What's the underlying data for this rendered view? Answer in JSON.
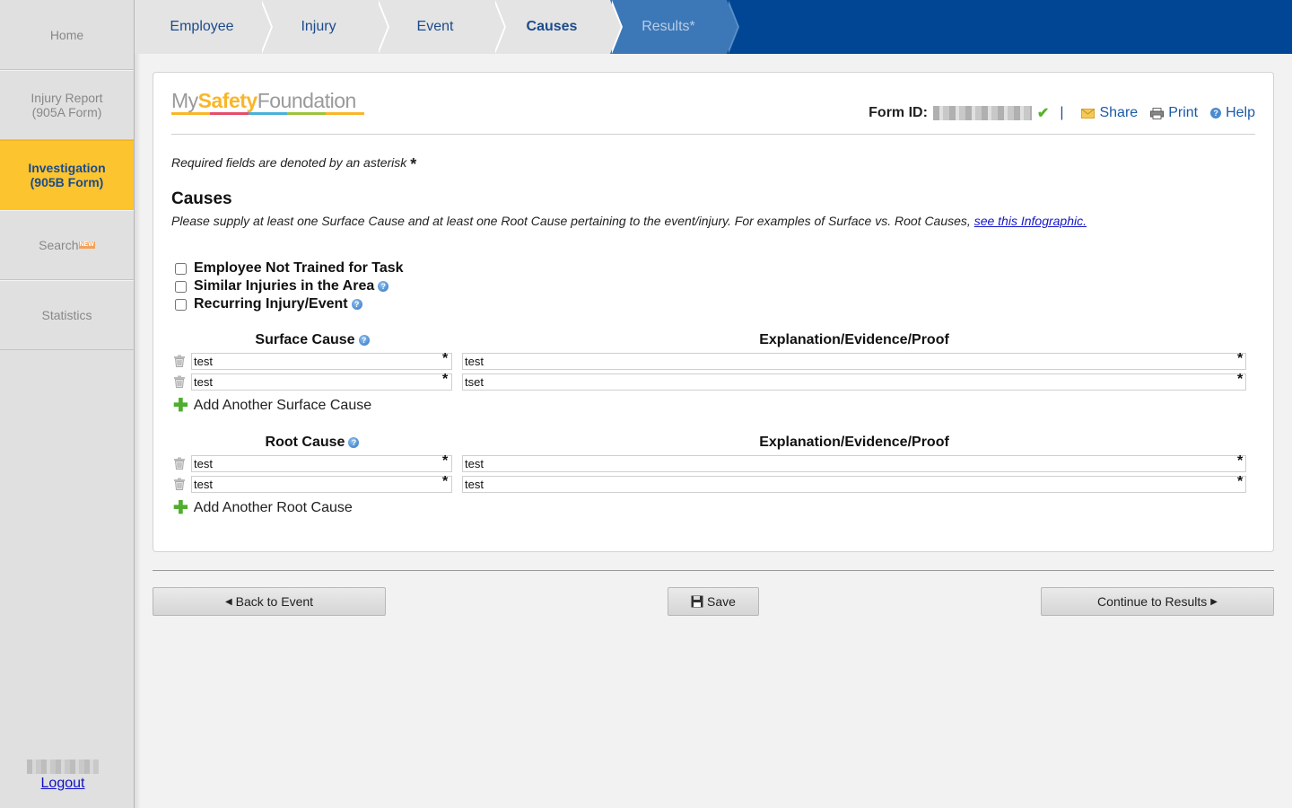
{
  "sidebar": {
    "items": [
      {
        "label": "Home"
      },
      {
        "label": "Injury Report\n(905A Form)"
      },
      {
        "label": "Investigation\n(905B Form)"
      },
      {
        "label": "Search",
        "badge": "NEW"
      },
      {
        "label": "Statistics"
      }
    ],
    "active_index": 2,
    "logout": "Logout"
  },
  "wizard": {
    "steps": [
      {
        "label": "Employee"
      },
      {
        "label": "Injury"
      },
      {
        "label": "Event"
      },
      {
        "label": "Causes"
      },
      {
        "label": "Results*"
      }
    ],
    "current": "Causes"
  },
  "header": {
    "logo_my": "My",
    "logo_safety": "Safety",
    "logo_foundation": "Foundation",
    "form_id_label": "Form ID:",
    "separator": "|",
    "share": "Share",
    "print": "Print",
    "help": "Help"
  },
  "form": {
    "required_note": "Required fields are denoted by an asterisk",
    "asterisk": "*",
    "section_title": "Causes",
    "section_desc": "Please supply at least one Surface Cause and at least one Root Cause pertaining to the event/injury. For examples of Surface vs. Root Causes,",
    "infographic_link": "see this Infographic.",
    "checkboxes": [
      {
        "label": "Employee Not Trained for Task",
        "help": false,
        "checked": false
      },
      {
        "label": "Similar Injuries in the Area",
        "help": true,
        "checked": false
      },
      {
        "label": "Recurring Injury/Event",
        "help": true,
        "checked": false
      }
    ],
    "surface": {
      "header": "Surface Cause",
      "explanation_header": "Explanation/Evidence/Proof",
      "rows": [
        {
          "cause": "test",
          "explanation": "test"
        },
        {
          "cause": "test",
          "explanation": "tset"
        }
      ],
      "add_label": "Add Another Surface Cause"
    },
    "root": {
      "header": "Root Cause",
      "explanation_header": "Explanation/Evidence/Proof",
      "rows": [
        {
          "cause": "test",
          "explanation": "test"
        },
        {
          "cause": "test",
          "explanation": "test"
        }
      ],
      "add_label": "Add Another Root Cause"
    }
  },
  "footer": {
    "back": "Back to Event",
    "save": "Save",
    "continue": "Continue to Results"
  },
  "colors": {
    "brand_blue": "#004694",
    "active_yellow": "#fcc42f",
    "link_blue": "#1c5aa8"
  }
}
